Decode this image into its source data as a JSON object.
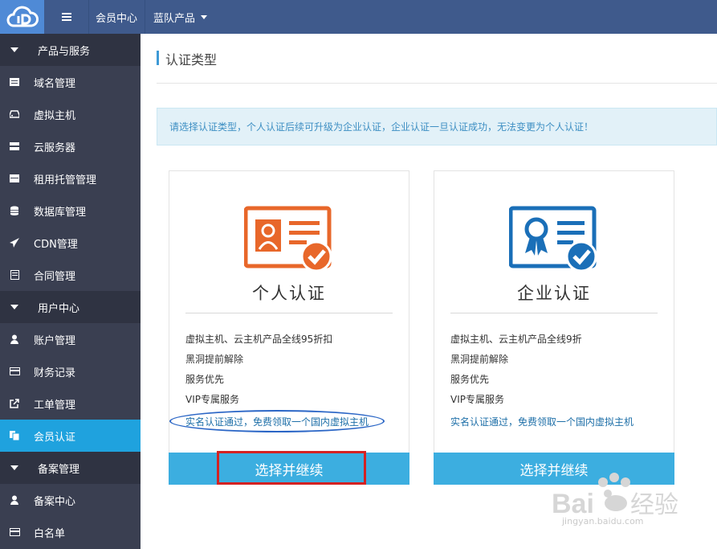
{
  "topbar": {
    "logo_icon": "cloud-logo-icon",
    "menu_icon": "hamburger-icon",
    "nav": [
      "会员中心",
      "蓝队产品"
    ]
  },
  "sidebar": {
    "sections": [
      {
        "title": "产品与服务",
        "items": [
          {
            "label": "域名管理",
            "icon": "domain-icon"
          },
          {
            "label": "虚拟主机",
            "icon": "hdd-icon"
          },
          {
            "label": "云服务器",
            "icon": "server-icon"
          },
          {
            "label": "租用托管管理",
            "icon": "server-rack-icon"
          },
          {
            "label": "数据库管理",
            "icon": "database-icon"
          },
          {
            "label": "CDN管理",
            "icon": "send-icon"
          },
          {
            "label": "合同管理",
            "icon": "document-icon"
          }
        ]
      },
      {
        "title": "用户中心",
        "items": [
          {
            "label": "账户管理",
            "icon": "user-icon"
          },
          {
            "label": "财务记录",
            "icon": "credit-card-icon"
          },
          {
            "label": "工单管理",
            "icon": "external-link-icon"
          },
          {
            "label": "会员认证",
            "icon": "copy-icon",
            "active": true
          }
        ]
      },
      {
        "title": "备案管理",
        "items": [
          {
            "label": "备案中心",
            "icon": "user-icon"
          },
          {
            "label": "白名单",
            "icon": "credit-card-icon"
          }
        ]
      }
    ]
  },
  "main": {
    "title": "认证类型",
    "notice": "请选择认证类型，个人认证后续可升级为企业认证，企业认证一旦认证成功，无法变更为个人认证！",
    "cards": [
      {
        "name": "个人认证",
        "icon": "personal-id-card-icon",
        "color": "#e8672a",
        "features": [
          "虚拟主机、云主机产品全线95折扣",
          "黑洞提前解除",
          "服务优先",
          "VIP专属服务"
        ],
        "link": "实名认证通过，免费领取一个国内虚拟主机",
        "button": "选择并继续"
      },
      {
        "name": "企业认证",
        "icon": "enterprise-certificate-icon",
        "color": "#1a6fb8",
        "features": [
          "虚拟主机、云主机产品全线9折",
          "黑洞提前解除",
          "服务优先",
          "VIP专属服务"
        ],
        "link": "实名认证通过，免费领取一个国内虚拟主机",
        "button": "选择并继续"
      }
    ]
  },
  "watermark": {
    "text": "jingyan.baidu.com"
  }
}
